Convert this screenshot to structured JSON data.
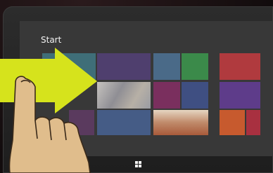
{
  "start_screen": {
    "title": "Start"
  },
  "tiles": [
    {
      "name": "tile-teal",
      "color": "#3f6e78"
    },
    {
      "name": "tile-purple-wide",
      "color": "#4f3f6e"
    },
    {
      "name": "tile-blue",
      "color": "#4a6a88"
    },
    {
      "name": "tile-green",
      "color": "#3b8a4a"
    },
    {
      "name": "tile-photo",
      "color": "#a7a2a0"
    },
    {
      "name": "tile-magenta",
      "color": "#7a2f5e"
    },
    {
      "name": "tile-navy",
      "color": "#3f4f82"
    },
    {
      "name": "tile-food",
      "color": "#c08a6a"
    },
    {
      "name": "tile-plum",
      "color": "#5a3a5e"
    },
    {
      "name": "tile-blue-wide",
      "color": "#455c86"
    },
    {
      "name": "tile-red",
      "color": "#b03a3e"
    },
    {
      "name": "tile-violet",
      "color": "#5e3c8a"
    },
    {
      "name": "tile-orange",
      "color": "#c75a2e"
    },
    {
      "name": "tile-crimson",
      "color": "#a83040"
    }
  ],
  "gesture": {
    "description_icon": "swipe-right-gesture",
    "arrow_color": "#d6e31c",
    "hand_color": "#e0bd8c"
  },
  "hardware": {
    "home_icon": "windows-logo-icon"
  }
}
